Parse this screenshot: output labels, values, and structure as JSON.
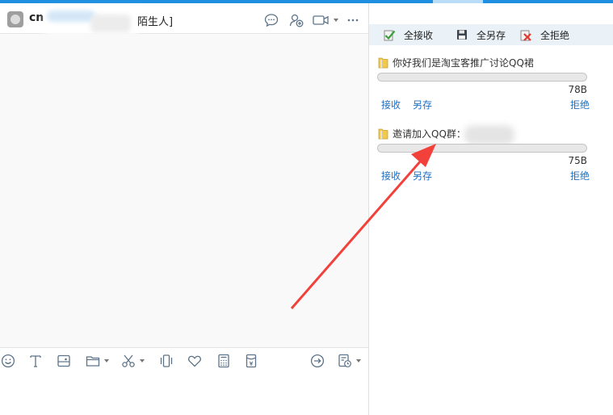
{
  "chat": {
    "contact_name": "cn",
    "contact_tag": "陌生人]",
    "header_icons": [
      "chat-bubble-icon",
      "invite-user-icon",
      "video-call-icon",
      "more-icon"
    ]
  },
  "toolbar": {
    "icons": [
      "emoji-icon",
      "font-icon",
      "image-icon",
      "folder-icon",
      "screenshot-scissors-icon",
      "shake-icon",
      "heart-icon",
      "calculator-icon",
      "red-packet-icon",
      "send-icon",
      "history-icon"
    ]
  },
  "file_panel": {
    "accept_all": "全接收",
    "save_all": "全另存",
    "reject_all": "全拒绝",
    "transfers": [
      {
        "name": "你好我们是淘宝客推广讨论QQ裙",
        "size": "78B",
        "progress": 0,
        "accept": "接收",
        "save_as": "另存",
        "reject": "拒绝"
      },
      {
        "name": "邀请加入QQ群：",
        "size": "75B",
        "progress": 0,
        "accept": "接收",
        "save_as": "另存",
        "reject": "拒绝"
      }
    ]
  },
  "colors": {
    "accent": "#1e8fe1",
    "link": "#1f6fc2",
    "annotation_arrow": "#f2403a"
  }
}
